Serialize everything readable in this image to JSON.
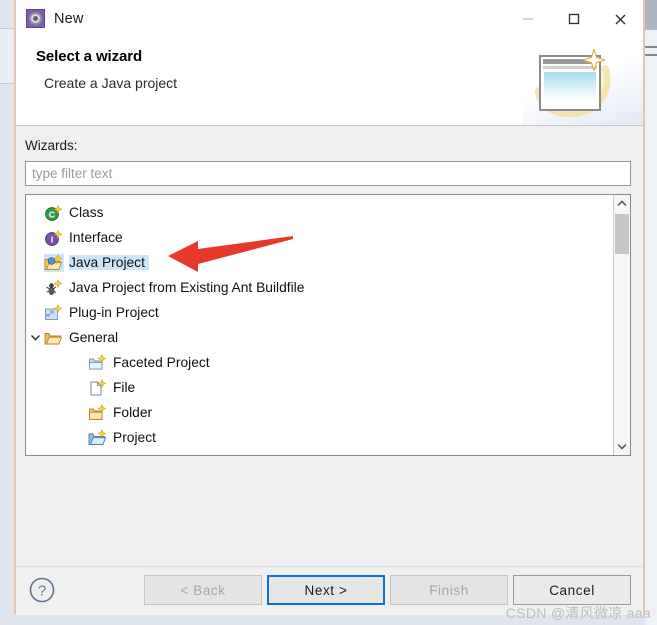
{
  "window": {
    "title": "New",
    "app_icon": "new-wizard-icon",
    "controls": {
      "minimize": "minimize-icon",
      "maximize": "maximize-icon",
      "close": "close-icon"
    },
    "border_color": "#e8c4ae"
  },
  "header": {
    "title": "Select a wizard",
    "subtitle": "Create a Java project",
    "banner_icon": "wizard-banner-icon"
  },
  "content": {
    "wizards_label": "Wizards:",
    "filter": {
      "value": "",
      "placeholder": "type filter text"
    },
    "tree": [
      {
        "label": "Class",
        "icon": "java-class-icon",
        "level": 0,
        "selected": false,
        "expandable": false
      },
      {
        "label": "Interface",
        "icon": "java-interface-icon",
        "level": 0,
        "selected": false,
        "expandable": false
      },
      {
        "label": "Java Project",
        "icon": "java-project-icon",
        "level": 0,
        "selected": true,
        "expandable": false
      },
      {
        "label": "Java Project from Existing Ant Buildfile",
        "icon": "ant-buildfile-icon",
        "level": 0,
        "selected": false,
        "expandable": false
      },
      {
        "label": "Plug-in Project",
        "icon": "plugin-project-icon",
        "level": 0,
        "selected": false,
        "expandable": false
      },
      {
        "label": "General",
        "icon": "open-folder-icon",
        "level": 0,
        "selected": false,
        "expandable": true,
        "expanded": true
      },
      {
        "label": "Faceted Project",
        "icon": "faceted-project-icon",
        "level": 1,
        "selected": false,
        "expandable": false
      },
      {
        "label": "File",
        "icon": "new-file-icon",
        "level": 1,
        "selected": false,
        "expandable": false
      },
      {
        "label": "Folder",
        "icon": "new-folder-icon",
        "level": 1,
        "selected": false,
        "expandable": false
      },
      {
        "label": "Project",
        "icon": "new-project-icon",
        "level": 1,
        "selected": false,
        "expandable": false
      }
    ],
    "scrollbar": {
      "up_arrow": "chevron-up-icon",
      "down_arrow": "chevron-down-icon"
    }
  },
  "footer": {
    "help_icon": "help-icon",
    "buttons": [
      {
        "label": "< Back",
        "state": "disabled"
      },
      {
        "label": "Next >",
        "state": "default"
      },
      {
        "label": "Finish",
        "state": "disabled"
      },
      {
        "label": "Cancel",
        "state": "enabled"
      }
    ]
  },
  "annotation": {
    "arrow_color": "#e8382c",
    "points_at": "Java Project"
  },
  "watermark": {
    "text": "CSDN @清风微凉 aaa"
  }
}
